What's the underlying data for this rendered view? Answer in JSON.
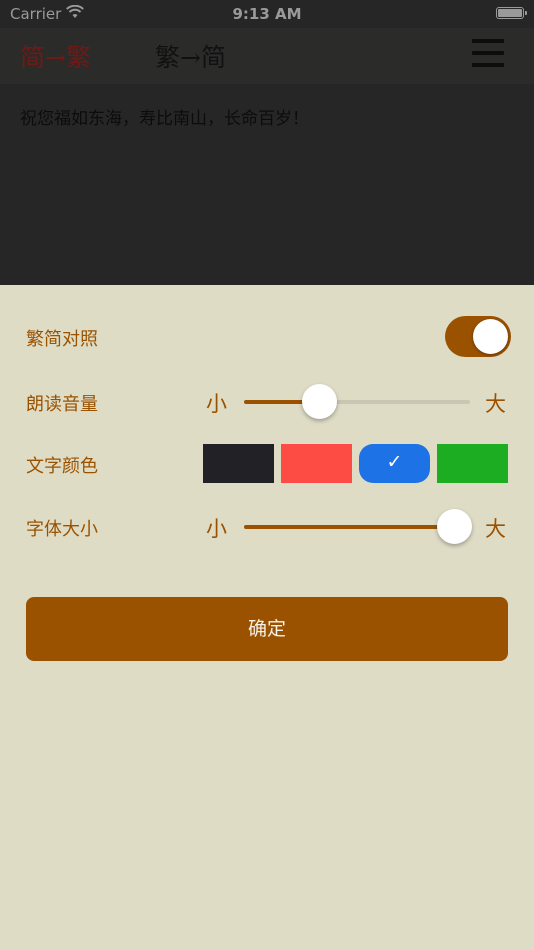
{
  "status_bar": {
    "carrier": "Carrier",
    "time": "9:13 AM"
  },
  "nav": {
    "mode_s2t": "简→繁",
    "mode_t2s": "繁→简",
    "menu_icon": "hamburger-menu-icon"
  },
  "content": {
    "text": "祝您福如东海，寿比南山，长命百岁！"
  },
  "settings": {
    "compare": {
      "label": "繁简对照",
      "enabled": true
    },
    "volume": {
      "label": "朗读音量",
      "min_label": "小",
      "max_label": "大",
      "value": 0.33
    },
    "text_color": {
      "label": "文字颜色",
      "options": [
        "#222226",
        "#fc4c44",
        "#1d72e6",
        "#1dad22"
      ],
      "selected": 2
    },
    "font_size": {
      "label": "字体大小",
      "min_label": "小",
      "max_label": "大",
      "value": 0.93
    },
    "confirm_label": "确定"
  },
  "colors": {
    "accent": "#9a5200",
    "panel_background": "#dfdcc6",
    "overlay": "#262626"
  }
}
